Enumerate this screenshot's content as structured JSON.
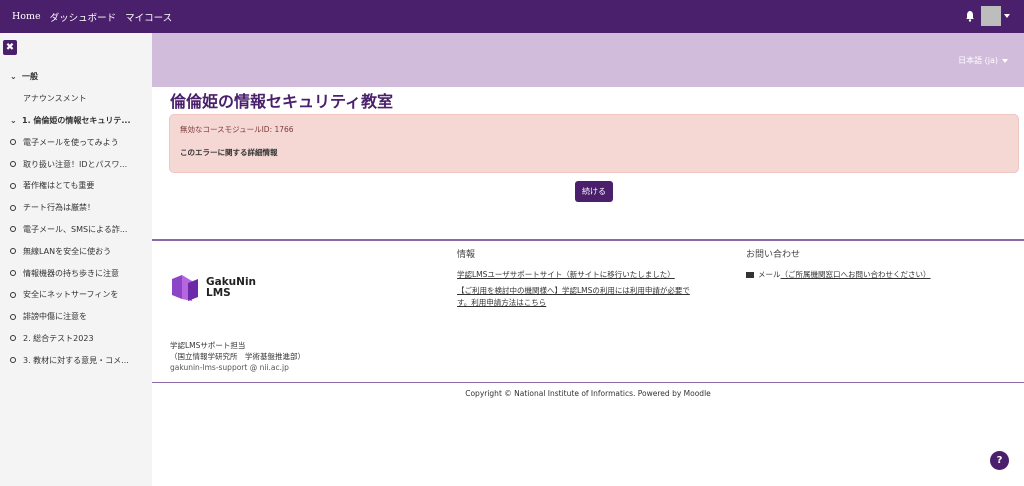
{
  "nav": {
    "home": "Home",
    "dashboard": "ダッシュボード",
    "my_courses": "マイコース"
  },
  "user": {
    "bell_icon": "bell-icon",
    "avatar": "avatar"
  },
  "sidebar": {
    "close_label": "✖",
    "items": [
      {
        "label": "一般",
        "type": "section"
      },
      {
        "label": "アナウンスメント",
        "type": "item"
      },
      {
        "label": "1. 倫倫姫の情報セキュリテ...",
        "type": "section"
      },
      {
        "label": "電子メールを使ってみよう",
        "type": "circle"
      },
      {
        "label": "取り扱い注意！IDとパスワ...",
        "type": "circle"
      },
      {
        "label": "著作権はとても重要",
        "type": "circle"
      },
      {
        "label": "チート行為は厳禁！",
        "type": "circle"
      },
      {
        "label": "電子メール、SMSによる詐...",
        "type": "circle"
      },
      {
        "label": "無線LANを安全に使おう",
        "type": "circle"
      },
      {
        "label": "情報機器の持ち歩きに注意",
        "type": "circle"
      },
      {
        "label": "安全にネットサーフィンを",
        "type": "circle"
      },
      {
        "label": "誹謗中傷に注意を",
        "type": "circle"
      },
      {
        "label": "2. 総合テスト2023",
        "type": "circle"
      },
      {
        "label": "3. 教材に対する意見・コメ...",
        "type": "circle"
      }
    ]
  },
  "language": "日本語 (ja)",
  "page_title": "倫倫姫の情報セキュリティ教室",
  "alert": {
    "message": "無効なコースモジュールID: 1766",
    "details_link": "このエラーに関する詳細情報"
  },
  "continue_button": "続ける",
  "footer": {
    "logo_line1": "GakuNin",
    "logo_line2": "LMS",
    "support_line1": "学認LMSサポート担当",
    "support_line2": "（国立情報学研究所　学術基盤推進部）",
    "support_email": "gakunin-lms-support @ nii.ac.jp",
    "info_title": "情報",
    "info_link1": "学認LMSユーザサポートサイト（新サイトに移行いたしました）",
    "info_link2a": "【ご利用を検討中の機関様へ】学認LMSの利用には利用申請が必要で",
    "info_link2b": "す。利用申請方法はこちら",
    "contact_title": "お問い合わせ",
    "contact_prefix": "メール",
    "contact_link": "（ご所属機関窓口へお問い合わせください）",
    "copyright": "Copyright © National Institute of Informatics. Powered by Moodle"
  },
  "help_label": "?",
  "colors": {
    "brand": "#4a1f6b",
    "header_band": "#d2bcdc",
    "alert_bg": "#f5d8d4"
  }
}
